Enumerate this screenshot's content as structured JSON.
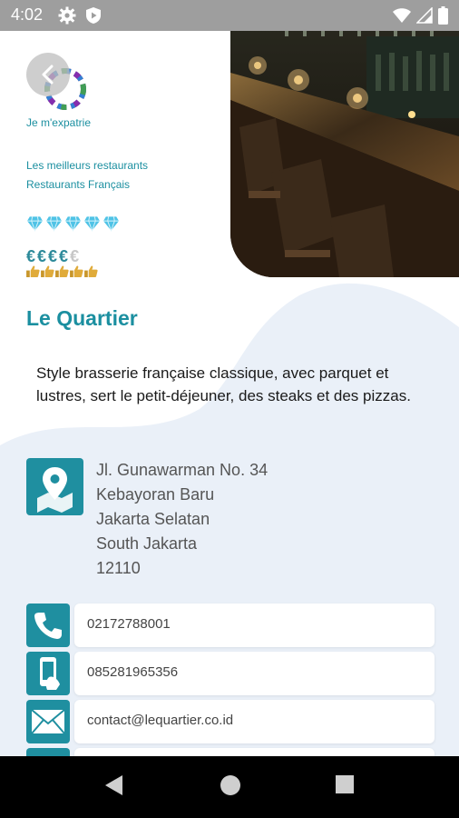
{
  "status_bar": {
    "time": "4:02",
    "icons": [
      "gear-icon",
      "shield-play-icon",
      "wifi-icon",
      "signal-icon",
      "battery-icon"
    ]
  },
  "header": {
    "back_icon": "chevron-left-icon",
    "logo_icon": "rainbow-ring-logo",
    "brand": "Je m'expatrie",
    "categories": [
      "Les meilleurs restaurants",
      "Restaurants Français"
    ]
  },
  "ratings": {
    "diamonds": 5,
    "price_level_shown": 4,
    "price_level_max": 5,
    "price_symbol": "€",
    "thumbs": 5,
    "accent_color": "#4fc3e6"
  },
  "restaurant": {
    "name": "Le Quartier",
    "description": "Style brasserie française classique, avec parquet et lustres, sert le petit-déjeuner, des steaks et des pizzas.",
    "address_lines": [
      "Jl. Gunawarman No. 34",
      "Kebayoran Baru",
      "Jakarta Selatan",
      "South Jakarta",
      "12110"
    ]
  },
  "contacts": [
    {
      "icon": "phone-icon",
      "value": "02172788001"
    },
    {
      "icon": "mobile-phone-icon",
      "value": "085281965356"
    },
    {
      "icon": "mail-icon",
      "value": "contact@lequartier.co.id"
    }
  ],
  "theme": {
    "primary": "#1f8fa0",
    "background_blob": "#eaf0f8"
  },
  "nav": {
    "icons": [
      "back-triangle-icon",
      "home-circle-icon",
      "recents-square-icon"
    ]
  }
}
